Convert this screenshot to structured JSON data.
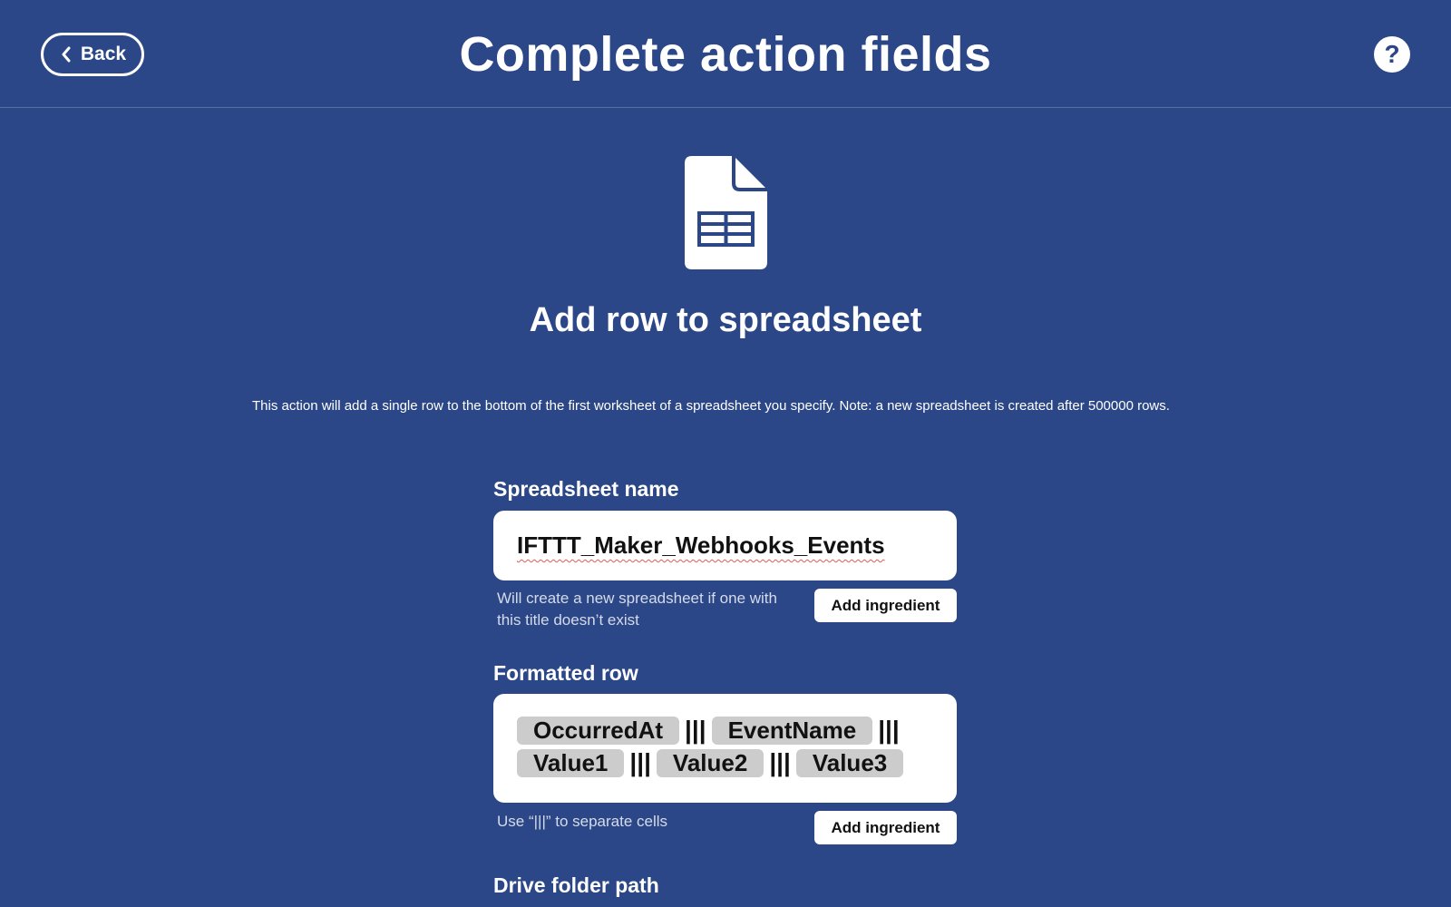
{
  "header": {
    "back_label": "Back",
    "title": "Complete action fields",
    "help_label": "?"
  },
  "action": {
    "icon": "spreadsheet-icon",
    "title": "Add row to spreadsheet",
    "description": "This action will add a single row to the bottom of the first worksheet of a spreadsheet you specify. Note: a new spreadsheet is created after 500000 rows."
  },
  "fields": {
    "spreadsheet_name": {
      "label": "Spreadsheet name",
      "value": "IFTTT_Maker_Webhooks_Events",
      "helper": "Will create a new spreadsheet if one with this title doesn’t exist",
      "button": "Add ingredient"
    },
    "formatted_row": {
      "label": "Formatted row",
      "ingredients": [
        "OccurredAt",
        "EventName",
        "Value1",
        "Value2",
        "Value3"
      ],
      "separator": "|||",
      "helper": "Use “|||” to separate cells",
      "button": "Add ingredient"
    },
    "drive_folder_path": {
      "label": "Drive folder path"
    }
  },
  "colors": {
    "background": "#2b4787",
    "pill": "#cccccc",
    "text_dark": "#111111"
  }
}
